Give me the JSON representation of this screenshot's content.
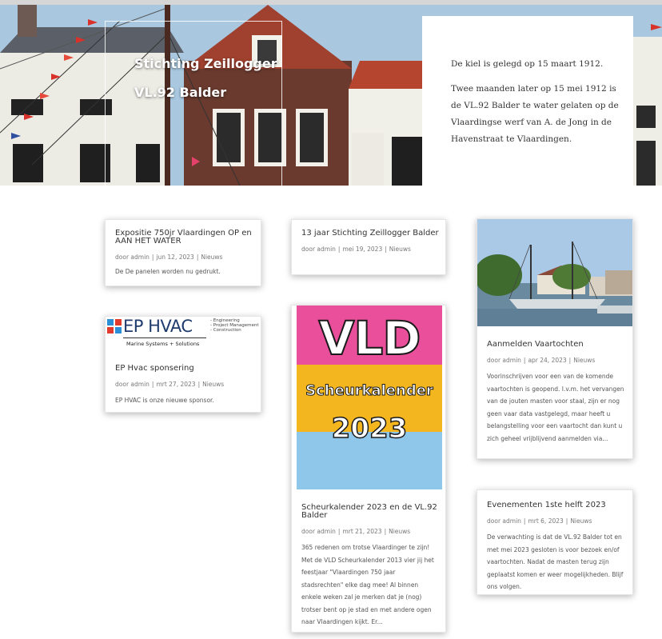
{
  "hero": {
    "title_line1": "Stichting Zeillogger",
    "title_line2": "VL.92 Balder",
    "panel_p1": "De kiel is gelegd op 15 maart 1912.",
    "panel_p2": "Twee maanden later op 15 mei 1912 is de VL.92 Balder te water gelaten op de Vlaardingse werf van A. de Jong in de Havenstraat te Vlaardingen."
  },
  "posts": [
    {
      "title": "Expositie 750jr Vlaardingen OP en AAN HET WATER",
      "author": "door admin",
      "date": "jun 12, 2023",
      "category": "Nieuws",
      "excerpt": "De De panelen worden nu gedrukt."
    },
    {
      "title": "13 jaar Stichting Zeillogger Balder",
      "author": "door admin",
      "date": "mei 19, 2023",
      "category": "Nieuws",
      "excerpt": ""
    },
    {
      "title": "Aanmelden Vaartochten",
      "author": "door admin",
      "date": "apr 24, 2023",
      "category": "Nieuws",
      "excerpt": "Voorinschrijven voor een van de komende vaartochten is geopend. I.v.m. het vervangen van de jouten masten voor staal, zijn er nog geen vaar data vastgelegd, maar heeft u belangstelling voor een vaartocht dan kunt u zich geheel vrijblijvend aanmelden via..."
    },
    {
      "title": "EP Hvac sponsering",
      "author": "door admin",
      "date": "mrt 27, 2023",
      "category": "Nieuws",
      "excerpt": "EP HVAC is onze nieuwe sponsor."
    },
    {
      "title": "Scheurkalender 2023 en de VL.92 Balder",
      "author": "door admin",
      "date": "mrt 21, 2023",
      "category": "Nieuws",
      "excerpt": "365 redenen om trotse Vlaardinger te zijn! Met de VLD Scheurkalender 2013 vier jij het feestjaar \"Vlaardingen 750 jaar stadsrechten\" elke dag mee! Al binnen enkele weken zal je merken dat je (nog) trotser bent op je stad en met andere ogen naar Vlaardingen kijkt. Er..."
    },
    {
      "title": "Evenementen 1ste helft 2023",
      "author": "door admin",
      "date": "mrt 6, 2023",
      "category": "Nieuws",
      "excerpt": "De verwachting is dat de VL.92 Balder tot en met mei 2023 gesloten is voor bezoek en/of vaartochten. Nadat de masten terug zijn geplaatst komen er weer mogelijkheden. Blijf ons volgen."
    }
  ],
  "ephvac_logo": {
    "brand": "EP HVAC",
    "services": [
      "- Engineering",
      "- Project Management",
      "- Construction"
    ],
    "tagline": "Marine Systems + Solutions"
  },
  "calendar_image": {
    "line1": "VLD",
    "line2": "Scheurkalender",
    "line3": "2023"
  },
  "meta_separator": "|",
  "colors": {
    "accent": "#2ea3f2",
    "text": "#333333",
    "meta": "#777777"
  }
}
